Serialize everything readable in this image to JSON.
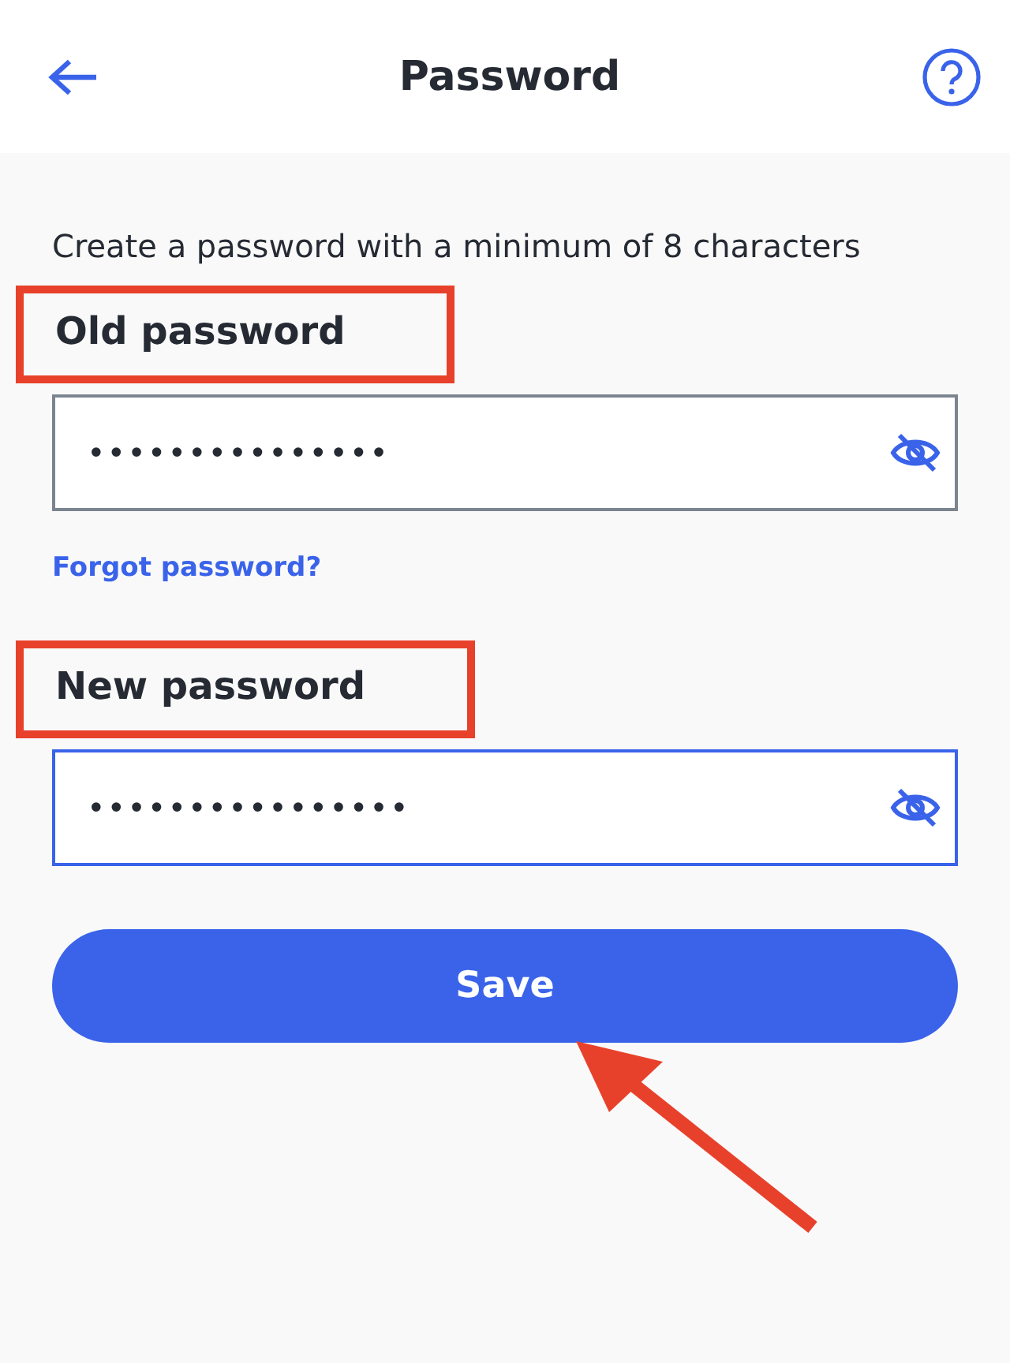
{
  "header": {
    "title": "Password"
  },
  "intro": "Create a password with a minimum of 8 characters",
  "fields": [
    {
      "label": "Old password",
      "highlighted": true,
      "value": "•••••••••••••••",
      "focused": false
    },
    {
      "label": "New password",
      "highlighted": true,
      "value": "••••••••••••••••",
      "focused": true
    }
  ],
  "forgot_link": "Forgot password?",
  "save_button": {
    "label": "Save",
    "pointer_arrow": true
  }
}
